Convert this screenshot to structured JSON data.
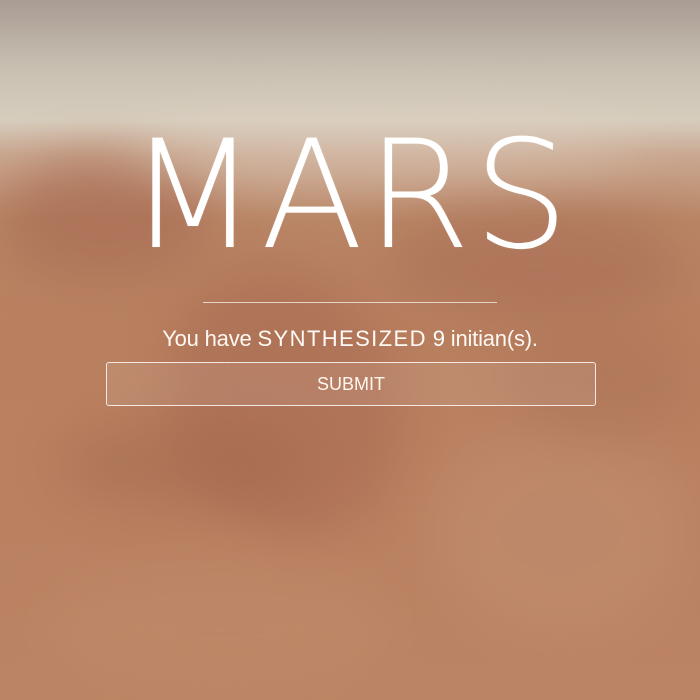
{
  "page": {
    "title": "MARS",
    "message": {
      "prefix": "You have",
      "verb": "SYNTHESIZED",
      "count": "9",
      "suffix": "initian(s)."
    },
    "submit_label": "SUBMIT"
  },
  "colors": {
    "text": "#ffffff",
    "button_border": "#ffffff",
    "background_sky": "#d7cdbd",
    "background_ground": "#b9805f"
  }
}
